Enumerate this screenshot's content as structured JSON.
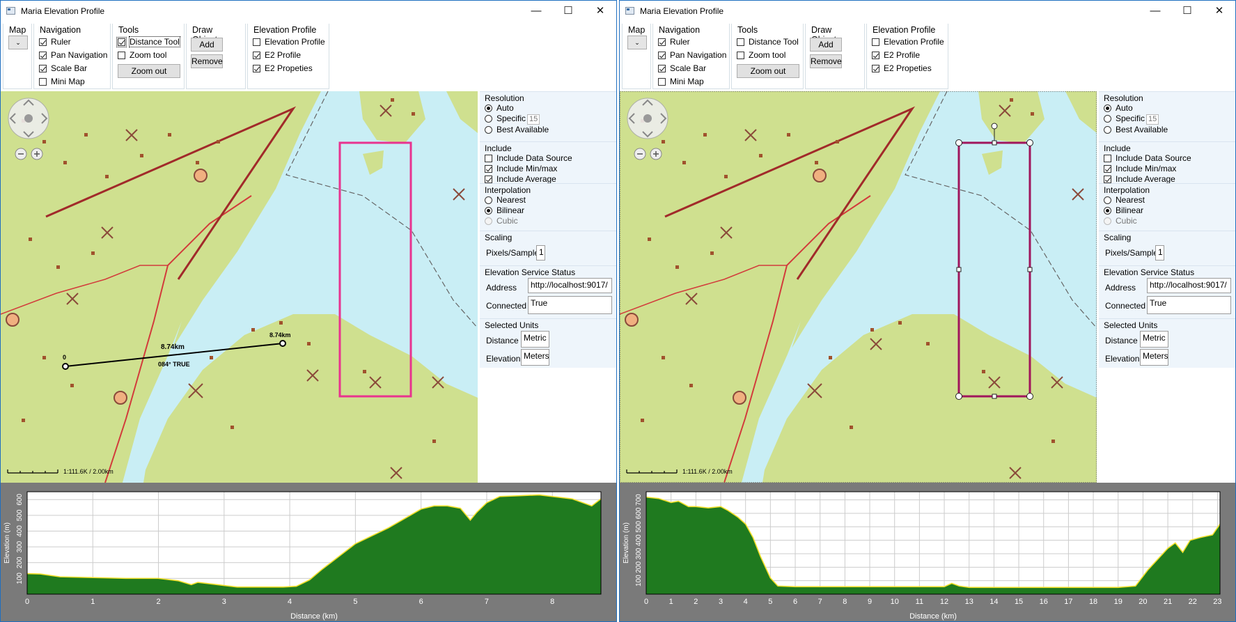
{
  "colors": {
    "water": "#c9eef5",
    "land": "#cfe08f",
    "route_red": "#b03030",
    "pink_rect": "#e8338f",
    "dark_rect": "#a0155c",
    "profile_fill": "#1f7a1f",
    "profile_line": "#f3e02a",
    "profile_frame": "#7a7a7a"
  },
  "windows": [
    {
      "title": "Maria Elevation Profile",
      "controls": {
        "minimize": "—",
        "maximize": "☐",
        "close": "✕"
      },
      "toolbar": {
        "map": {
          "title": "Map",
          "combo_glyph": "⌄"
        },
        "navigation": {
          "title": "Navigation",
          "items": [
            {
              "label": "Ruler",
              "checked": true
            },
            {
              "label": "Pan Navigation",
              "checked": true
            },
            {
              "label": "Scale Bar",
              "checked": true
            },
            {
              "label": "Mini Map",
              "checked": false
            }
          ]
        },
        "tools": {
          "title": "Tools",
          "items": [
            {
              "label": "Distance Tool",
              "checked": true
            },
            {
              "label": "Zoom tool",
              "checked": false
            }
          ],
          "zoom_out": "Zoom out"
        },
        "draw_objects": {
          "title": "Draw Objects",
          "add": "Add",
          "remove": "Remove"
        },
        "elevation_profile": {
          "title": "Elevation Profile",
          "items": [
            {
              "label": "Elevation Profile",
              "checked": false
            },
            {
              "label": "E2 Profile",
              "checked": true
            },
            {
              "label": "E2 Propeties",
              "checked": true
            }
          ]
        }
      },
      "map": {
        "scale_text": "1:111.6K / 2.00km",
        "ruler_start": "0",
        "ruler_end": "8.74km",
        "ruler_mid": "8.74km",
        "ruler_bearing": "084° TRUE",
        "selection_style": "pink"
      },
      "panel": {
        "resolution": {
          "title": "Resolution",
          "auto": "Auto",
          "specific": "Specific",
          "specific_value": "15",
          "best": "Best Available"
        },
        "include": {
          "title": "Include",
          "items": [
            {
              "label": "Include Data Source",
              "checked": false
            },
            {
              "label": "Include Min/max",
              "checked": true
            },
            {
              "label": "Include Average",
              "checked": true
            }
          ]
        },
        "interpolation": {
          "title": "Interpolation",
          "items": [
            "Nearest",
            "Bilinear",
            "Cubic"
          ],
          "selected": "Bilinear"
        },
        "scaling": {
          "title": "Scaling",
          "label": "Pixels/Sample",
          "value": "1"
        },
        "service": {
          "title": "Elevation Service Status",
          "address_label": "Address",
          "address": "http://localhost:9017/",
          "connected_label": "Connected",
          "connected": "True"
        },
        "units": {
          "title": "Selected Units",
          "distance_label": "Distance",
          "distance": "Metric",
          "elevation_label": "Elevation",
          "elevation": "Meters"
        }
      },
      "chart_data": {
        "type": "area",
        "xlabel": "Distance (km)",
        "ylabel": "Elevation (m)",
        "xlim": [
          0,
          8.74
        ],
        "ylim": [
          0,
          650
        ],
        "x_ticks": [
          0,
          1,
          2,
          3,
          4,
          5,
          6,
          7,
          8
        ],
        "y_ticks": [
          100,
          200,
          300,
          400,
          500,
          600
        ],
        "grid": true,
        "x": [
          0,
          0.2,
          0.5,
          1,
          1.5,
          2,
          2.3,
          2.5,
          2.6,
          2.8,
          3,
          3.2,
          3.5,
          3.9,
          4.1,
          4.3,
          4.5,
          5,
          5.5,
          6,
          6.2,
          6.4,
          6.6,
          6.75,
          6.85,
          7,
          7.2,
          7.5,
          7.8,
          8,
          8.3,
          8.6,
          8.74
        ],
        "y": [
          130,
          128,
          110,
          105,
          100,
          100,
          85,
          60,
          75,
          65,
          55,
          45,
          45,
          45,
          50,
          90,
          160,
          320,
          420,
          540,
          560,
          560,
          545,
          470,
          520,
          580,
          620,
          625,
          630,
          620,
          605,
          560,
          605
        ]
      }
    },
    {
      "title": "Maria Elevation Profile",
      "controls": {
        "minimize": "—",
        "maximize": "☐",
        "close": "✕"
      },
      "toolbar": {
        "map": {
          "title": "Map",
          "combo_glyph": "⌄"
        },
        "navigation": {
          "title": "Navigation",
          "items": [
            {
              "label": "Ruler",
              "checked": true
            },
            {
              "label": "Pan Navigation",
              "checked": true
            },
            {
              "label": "Scale Bar",
              "checked": true
            },
            {
              "label": "Mini Map",
              "checked": false
            }
          ]
        },
        "tools": {
          "title": "Tools",
          "items": [
            {
              "label": "Distance Tool",
              "checked": false
            },
            {
              "label": "Zoom tool",
              "checked": false
            }
          ],
          "zoom_out": "Zoom out"
        },
        "draw_objects": {
          "title": "Draw Objects",
          "add": "Add",
          "remove": "Remove"
        },
        "elevation_profile": {
          "title": "Elevation Profile",
          "items": [
            {
              "label": "Elevation Profile",
              "checked": false
            },
            {
              "label": "E2 Profile",
              "checked": true
            },
            {
              "label": "E2 Propeties",
              "checked": true
            }
          ]
        }
      },
      "map": {
        "scale_text": "1:111.6K / 2.00km",
        "selection_style": "edit"
      },
      "panel": {
        "resolution": {
          "title": "Resolution",
          "auto": "Auto",
          "specific": "Specific",
          "specific_value": "15",
          "best": "Best Available"
        },
        "include": {
          "title": "Include",
          "items": [
            {
              "label": "Include Data Source",
              "checked": false
            },
            {
              "label": "Include Min/max",
              "checked": true
            },
            {
              "label": "Include Average",
              "checked": true
            }
          ]
        },
        "interpolation": {
          "title": "Interpolation",
          "items": [
            "Nearest",
            "Bilinear",
            "Cubic"
          ],
          "selected": "Bilinear"
        },
        "scaling": {
          "title": "Scaling",
          "label": "Pixels/Sample",
          "value": "1"
        },
        "service": {
          "title": "Elevation Service Status",
          "address_label": "Address",
          "address": "http://localhost:9017/",
          "connected_label": "Connected",
          "connected": "True"
        },
        "units": {
          "title": "Selected Units",
          "distance_label": "Distance",
          "distance": "Metric",
          "elevation_label": "Elevation",
          "elevation": "Meters"
        }
      },
      "chart_data": {
        "type": "area",
        "xlabel": "Distance (km)",
        "ylabel": "Elevation (m)",
        "xlim": [
          0,
          23.1
        ],
        "ylim": [
          0,
          760
        ],
        "x_ticks": [
          0,
          1,
          2,
          3,
          4,
          5,
          6,
          7,
          8,
          9,
          10,
          11,
          12,
          13,
          14,
          15,
          16,
          17,
          18,
          19,
          20,
          21,
          22,
          23
        ],
        "y_ticks": [
          100,
          200,
          300,
          400,
          500,
          600,
          700
        ],
        "grid": true,
        "x": [
          0,
          0.5,
          1,
          1.3,
          1.7,
          2,
          2.5,
          3,
          3.3,
          3.7,
          4,
          4.3,
          4.6,
          5,
          5.3,
          6,
          8,
          10,
          12,
          12.3,
          12.6,
          13,
          15,
          17,
          19,
          19.7,
          20.2,
          20.6,
          21,
          21.3,
          21.6,
          21.9,
          22.3,
          22.8,
          23.1
        ],
        "y": [
          720,
          710,
          680,
          690,
          650,
          650,
          640,
          650,
          620,
          570,
          520,
          420,
          280,
          120,
          60,
          55,
          55,
          55,
          55,
          80,
          60,
          50,
          50,
          50,
          50,
          60,
          180,
          260,
          340,
          380,
          310,
          400,
          420,
          440,
          520
        ]
      }
    }
  ]
}
